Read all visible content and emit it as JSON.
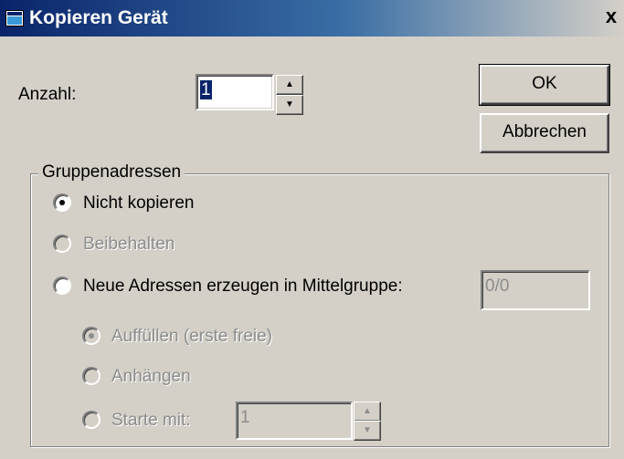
{
  "window": {
    "title": "Kopieren Gerät",
    "close_label": "x"
  },
  "count": {
    "label": "Anzahl:",
    "value": "1",
    "spin_up": "▲",
    "spin_down": "▼"
  },
  "buttons": {
    "ok": "OK",
    "cancel": "Abbrechen"
  },
  "group": {
    "title": "Gruppenadressen",
    "options": {
      "nicht_kopieren": "Nicht kopieren",
      "beibehalten": "Beibehalten",
      "neue_adressen": "Neue Adressen erzeugen in Mittelgruppe:"
    },
    "mittelgruppe_value": "0/0",
    "sub_options": {
      "auffuellen": "Auffüllen (erste freie)",
      "anhaengen": "Anhängen",
      "starte_mit": "Starte mit:"
    },
    "starte_mit_value": "1",
    "selected": "Nicht kopieren",
    "sub_selected": "Auffüllen (erste freie)"
  },
  "colors": {
    "face": "#d4d0c8",
    "title_start": "#0a246a",
    "title_end": "#d4d0c8",
    "disabled_text": "#8c8c8c"
  }
}
